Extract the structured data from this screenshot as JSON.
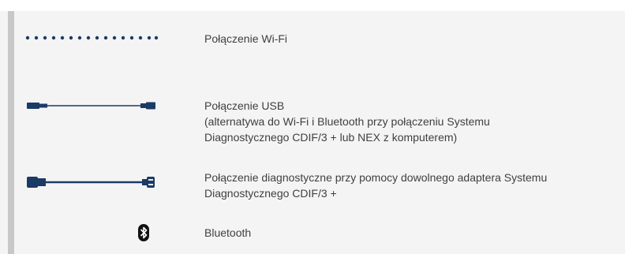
{
  "accent_color": "#1c3a66",
  "legend": [
    {
      "icon": "wifi-dotted-line-icon",
      "lines": [
        "Połączenie Wi-Fi"
      ]
    },
    {
      "icon": "usb-cable-icon",
      "lines": [
        "Połączenie USB",
        "(alternatywa do Wi-Fi i Bluetooth przy połączeniu Systemu",
        "Diagnostycznego CDIF/3  + lub NEX z komputerem)"
      ]
    },
    {
      "icon": "diagnostic-cable-icon",
      "lines": [
        "Połączenie diagnostyczne przy pomocy dowolnego adaptera Systemu",
        "Diagnostycznego CDIF/3  +"
      ]
    },
    {
      "icon": "bluetooth-icon",
      "lines": [
        "Bluetooth"
      ]
    }
  ]
}
